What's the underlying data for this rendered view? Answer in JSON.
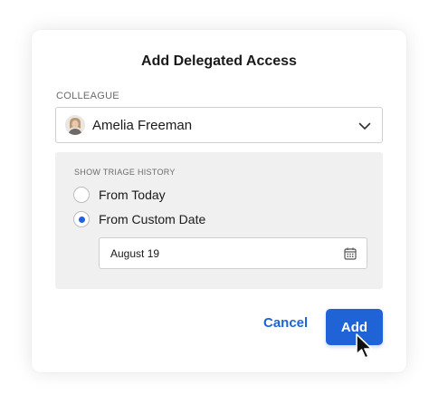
{
  "dialog": {
    "title": "Add Delegated Access"
  },
  "colleague": {
    "label": "COLLEAGUE",
    "selected": "Amelia Freeman"
  },
  "triage": {
    "label": "SHOW TRIAGE HISTORY",
    "options": [
      {
        "label": "From Today",
        "checked": false
      },
      {
        "label": "From Custom Date",
        "checked": true
      }
    ],
    "date_value": "August 19"
  },
  "actions": {
    "cancel_label": "Cancel",
    "add_label": "Add"
  },
  "colors": {
    "accent": "#1f63d6",
    "panel_bg": "#f0f0f0"
  },
  "icons": {
    "dropdown": "chevron-down-icon",
    "calendar": "calendar-icon",
    "cursor": "mouse-pointer-icon"
  }
}
